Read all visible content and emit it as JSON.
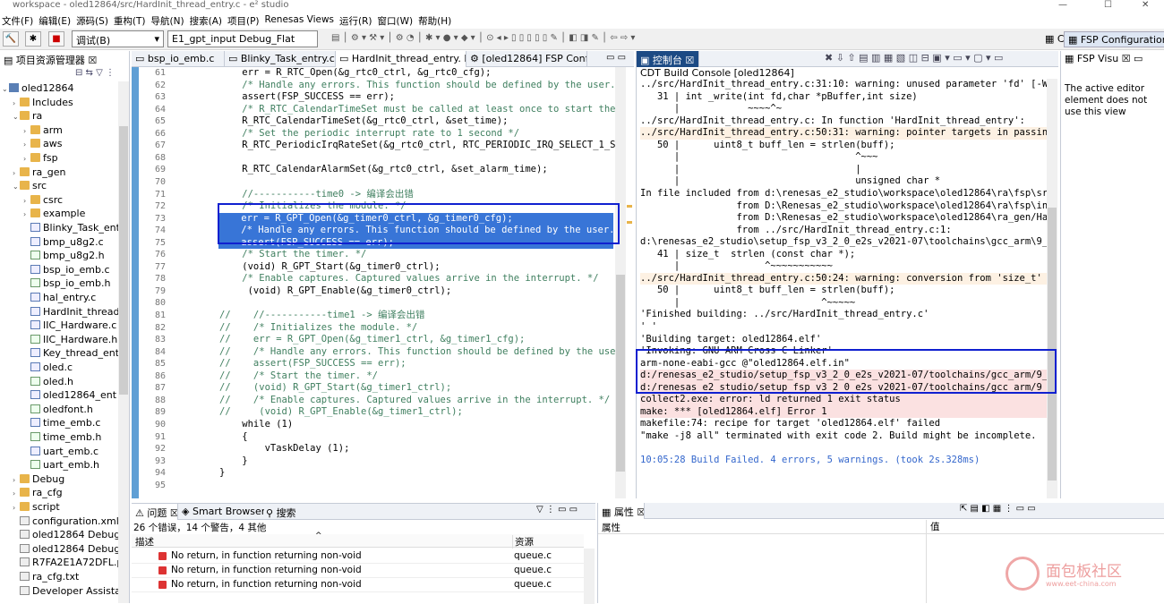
{
  "window": {
    "title": "workspace - oled12864/src/HardInit_thread_entry.c - e² studio"
  },
  "menu": [
    "文件(F)",
    "编辑(E)",
    "源码(S)",
    "重构(T)",
    "导航(N)",
    "搜索(A)",
    "项目(P)",
    "Renesas Views",
    "运行(R)",
    "窗口(W)",
    "帮助(H)"
  ],
  "toolbar": {
    "mode": "调试(B)",
    "launch": "E1_gpt_input Debug_Flat",
    "persp_c": "C",
    "persp_fsp": "FSP Configuration"
  },
  "explorer": {
    "title": "项目资源管理器",
    "items": [
      {
        "label": "oled12864",
        "depth": 0,
        "type": "proj",
        "open": true
      },
      {
        "label": "Includes",
        "depth": 1,
        "type": "folder"
      },
      {
        "label": "ra",
        "depth": 1,
        "type": "folder",
        "open": true
      },
      {
        "label": "arm",
        "depth": 2,
        "type": "folder"
      },
      {
        "label": "aws",
        "depth": 2,
        "type": "folder"
      },
      {
        "label": "fsp",
        "depth": 2,
        "type": "folder"
      },
      {
        "label": "ra_gen",
        "depth": 1,
        "type": "folder"
      },
      {
        "label": "src",
        "depth": 1,
        "type": "folder",
        "open": true
      },
      {
        "label": "csrc",
        "depth": 2,
        "type": "folder"
      },
      {
        "label": "example",
        "depth": 2,
        "type": "folder"
      },
      {
        "label": "Blinky_Task_ent",
        "depth": 2,
        "type": "cfile"
      },
      {
        "label": "bmp_u8g2.c",
        "depth": 2,
        "type": "cfile"
      },
      {
        "label": "bmp_u8g2.h",
        "depth": 2,
        "type": "hfile"
      },
      {
        "label": "bsp_io_emb.c",
        "depth": 2,
        "type": "cfile"
      },
      {
        "label": "bsp_io_emb.h",
        "depth": 2,
        "type": "hfile"
      },
      {
        "label": "hal_entry.c",
        "depth": 2,
        "type": "cfile"
      },
      {
        "label": "HardInit_thread",
        "depth": 2,
        "type": "cfile"
      },
      {
        "label": "IIC_Hardware.c",
        "depth": 2,
        "type": "cfile"
      },
      {
        "label": "IIC_Hardware.h",
        "depth": 2,
        "type": "hfile"
      },
      {
        "label": "Key_thread_ent",
        "depth": 2,
        "type": "cfile"
      },
      {
        "label": "oled.c",
        "depth": 2,
        "type": "cfile"
      },
      {
        "label": "oled.h",
        "depth": 2,
        "type": "hfile"
      },
      {
        "label": "oled12864_ent",
        "depth": 2,
        "type": "cfile"
      },
      {
        "label": "oledfont.h",
        "depth": 2,
        "type": "hfile"
      },
      {
        "label": "time_emb.c",
        "depth": 2,
        "type": "cfile"
      },
      {
        "label": "time_emb.h",
        "depth": 2,
        "type": "hfile"
      },
      {
        "label": "uart_emb.c",
        "depth": 2,
        "type": "cfile"
      },
      {
        "label": "uart_emb.h",
        "depth": 2,
        "type": "hfile"
      },
      {
        "label": "Debug",
        "depth": 1,
        "type": "folder"
      },
      {
        "label": "ra_cfg",
        "depth": 1,
        "type": "folder"
      },
      {
        "label": "script",
        "depth": 1,
        "type": "folder"
      },
      {
        "label": "configuration.xml",
        "depth": 1,
        "type": "file"
      },
      {
        "label": "oled12864 Debug",
        "depth": 1,
        "type": "file"
      },
      {
        "label": "oled12864 Debug",
        "depth": 1,
        "type": "file"
      },
      {
        "label": "R7FA2E1A72DFL.p",
        "depth": 1,
        "type": "file"
      },
      {
        "label": "ra_cfg.txt",
        "depth": 1,
        "type": "file"
      },
      {
        "label": "Developer Assista",
        "depth": 1,
        "type": "file"
      }
    ]
  },
  "editor_tabs": [
    "bsp_io_emb.c",
    "Blinky_Task_entry.c",
    "HardInit_thread_entry.",
    "[oled12864] FSP Config"
  ],
  "code_lines": [
    {
      "n": "61",
      "t": "    err = R_RTC_Open(&g_rtc0_ctrl, &g_rtc0_cfg);",
      "c": ""
    },
    {
      "n": "62",
      "t": "    /* Handle any errors. This function should be defined by the user. *",
      "c": "cmt"
    },
    {
      "n": "63",
      "t": "    assert(FSP_SUCCESS == err);",
      "c": ""
    },
    {
      "n": "64",
      "t": "    /* R_RTC_CalendarTimeSet must be called at least once to start the R",
      "c": "cmt"
    },
    {
      "n": "65",
      "t": "    R_RTC_CalendarTimeSet(&g_rtc0_ctrl, &set_time);",
      "c": ""
    },
    {
      "n": "66",
      "t": "    /* Set the periodic interrupt rate to 1 second */",
      "c": "cmt"
    },
    {
      "n": "67",
      "t": "    R_RTC_PeriodicIrqRateSet(&g_rtc0_ctrl, RTC_PERIODIC_IRQ_SELECT_1_SEC",
      "c": ""
    },
    {
      "n": "68",
      "t": "",
      "c": ""
    },
    {
      "n": "69",
      "t": "    R_RTC_CalendarAlarmSet(&g_rtc0_ctrl, &set_alarm_time);",
      "c": ""
    },
    {
      "n": "70",
      "t": "",
      "c": ""
    },
    {
      "n": "71",
      "t": "    //-----------time0 -> 编译会出错",
      "c": "cmt"
    },
    {
      "n": "72",
      "t": "    /* Initializes the module. */",
      "c": "cmt"
    },
    {
      "n": "73",
      "t": "    err = R_GPT_Open(&g_timer0_ctrl, &g_timer0_cfg);",
      "c": "sel"
    },
    {
      "n": "74",
      "t": "    /* Handle any errors. This function should be defined by the user. *",
      "c": "sel"
    },
    {
      "n": "75",
      "t": "    assert(FSP_SUCCESS == err);",
      "c": "sel"
    },
    {
      "n": "76",
      "t": "    /* Start the timer. */",
      "c": "cmt"
    },
    {
      "n": "77",
      "t": "    (void) R_GPT_Start(&g_timer0_ctrl);",
      "c": ""
    },
    {
      "n": "78",
      "t": "    /* Enable captures. Captured values arrive in the interrupt. */",
      "c": "cmt"
    },
    {
      "n": "79",
      "t": "     (void) R_GPT_Enable(&g_timer0_ctrl);",
      "c": ""
    },
    {
      "n": "80",
      "t": "",
      "c": ""
    },
    {
      "n": "81",
      "t": "//    //-----------time1 -> 编译会出错",
      "c": "cmt"
    },
    {
      "n": "82",
      "t": "//    /* Initializes the module. */",
      "c": "cmt"
    },
    {
      "n": "83",
      "t": "//    err = R_GPT_Open(&g_timer1_ctrl, &g_timer1_cfg);",
      "c": "cmt"
    },
    {
      "n": "84",
      "t": "//    /* Handle any errors. This function should be defined by the user.",
      "c": "cmt"
    },
    {
      "n": "85",
      "t": "//    assert(FSP_SUCCESS == err);",
      "c": "cmt"
    },
    {
      "n": "86",
      "t": "//    /* Start the timer. */",
      "c": "cmt"
    },
    {
      "n": "87",
      "t": "//    (void) R_GPT_Start(&g_timer1_ctrl);",
      "c": "cmt"
    },
    {
      "n": "88",
      "t": "//    /* Enable captures. Captured values arrive in the interrupt. */",
      "c": "cmt"
    },
    {
      "n": "89",
      "t": "//     (void) R_GPT_Enable(&g_timer1_ctrl);",
      "c": "cmt"
    },
    {
      "n": "90",
      "t": "    while (1)",
      "c": ""
    },
    {
      "n": "91",
      "t": "    {",
      "c": ""
    },
    {
      "n": "92",
      "t": "        vTaskDelay (1);",
      "c": ""
    },
    {
      "n": "93",
      "t": "    }",
      "c": ""
    },
    {
      "n": "94",
      "t": "}",
      "c": ""
    },
    {
      "n": "95",
      "t": "",
      "c": ""
    }
  ],
  "console": {
    "tab": "控制台",
    "title": "CDT Build Console [oled12864]",
    "lines": [
      {
        "t": "../src/HardInit_thread_entry.c:31:10: warning: unused parameter 'fd' [-Wunu",
        "c": ""
      },
      {
        "t": "   31 | int _write(int fd,char *pBuffer,int size)",
        "c": ""
      },
      {
        "t": "      |            ~~~~^~",
        "c": ""
      },
      {
        "t": "../src/HardInit_thread_entry.c: In function 'HardInit_thread_entry':",
        "c": ""
      },
      {
        "t": "../src/HardInit_thread_entry.c:50:31: warning: pointer targets in passing a",
        "c": "warn"
      },
      {
        "t": "   50 |      uint8_t buff_len = strlen(buff);",
        "c": ""
      },
      {
        "t": "      |                               ^~~~",
        "c": ""
      },
      {
        "t": "      |                               |",
        "c": ""
      },
      {
        "t": "      |                               unsigned char *",
        "c": ""
      },
      {
        "t": "In file included from d:\\renesas_e2_studio\\workspace\\oled12864\\ra\\fsp\\src\\",
        "c": ""
      },
      {
        "t": "                 from D:\\Renesas_e2_studio\\workspace\\oled12864\\ra\\fsp\\inc\\a",
        "c": ""
      },
      {
        "t": "                 from D:\\Renesas_e2_studio\\workspace\\oled12864\\ra_gen/HardI",
        "c": ""
      },
      {
        "t": "                 from ../src/HardInit_thread_entry.c:1:",
        "c": ""
      },
      {
        "t": "d:\\renesas_e2_studio\\setup_fsp_v3_2_0_e2s_v2021-07\\toolchains\\gcc_arm\\9_20",
        "c": ""
      },
      {
        "t": "   41 | size_t  strlen (const char *);",
        "c": ""
      },
      {
        "t": "      |               ^~~~~~~~~~~~",
        "c": ""
      },
      {
        "t": "../src/HardInit_thread_entry.c:50:24: warning: conversion from 'size_t' {aka",
        "c": "warn"
      },
      {
        "t": "   50 |      uint8_t buff_len = strlen(buff);",
        "c": ""
      },
      {
        "t": "      |                         ^~~~~~",
        "c": ""
      },
      {
        "t": "'Finished building: ../src/HardInit_thread_entry.c'",
        "c": ""
      },
      {
        "t": "' '",
        "c": ""
      },
      {
        "t": "'Building target: oled12864.elf'",
        "c": ""
      },
      {
        "t": "'Invoking: GNU ARM Cross C Linker'",
        "c": ""
      },
      {
        "t": "arm-none-eabi-gcc @\"oled12864.elf.in\"",
        "c": ""
      },
      {
        "t": "d:/renesas_e2_studio/setup_fsp_v3_2_0_e2s_v2021-07/toolchains/gcc_arm/9_202",
        "c": "err"
      },
      {
        "t": "d:/renesas_e2_studio/setup_fsp_v3_2_0_e2s_v2021-07/toolchains/gcc_arm/9_202",
        "c": "err"
      },
      {
        "t": "collect2.exe: error: ld returned 1 exit status",
        "c": "err"
      },
      {
        "t": "make: *** [oled12864.elf] Error 1",
        "c": "err"
      },
      {
        "t": "makefile:74: recipe for target 'oled12864.elf' failed",
        "c": ""
      },
      {
        "t": "\"make -j8 all\" terminated with exit code 2. Build might be incomplete.",
        "c": ""
      },
      {
        "t": "",
        "c": ""
      },
      {
        "t": "10:05:28 Build Failed. 4 errors, 5 warnings. (took 2s.328ms)",
        "c": "link"
      }
    ]
  },
  "visual": {
    "tab": "FSP Visu",
    "message": "The active editor element does not use this view"
  },
  "problems": {
    "tab": "问题",
    "tab2": "Smart Browser",
    "tab3": "搜索",
    "summary": "26 个错误，14 个警告，4 其他",
    "col_desc": "描述",
    "col_res": "资源",
    "rows": [
      {
        "desc": "No return, in function returning non-void",
        "res": "queue.c"
      },
      {
        "desc": "No return, in function returning non-void",
        "res": "queue.c"
      },
      {
        "desc": "No return, in function returning non-void",
        "res": "queue.c"
      }
    ]
  },
  "properties": {
    "tab": "属性",
    "col_prop": "属性",
    "col_val": "值"
  },
  "watermark": {
    "text": "面包板社区",
    "url": "www.eet-china.com"
  }
}
